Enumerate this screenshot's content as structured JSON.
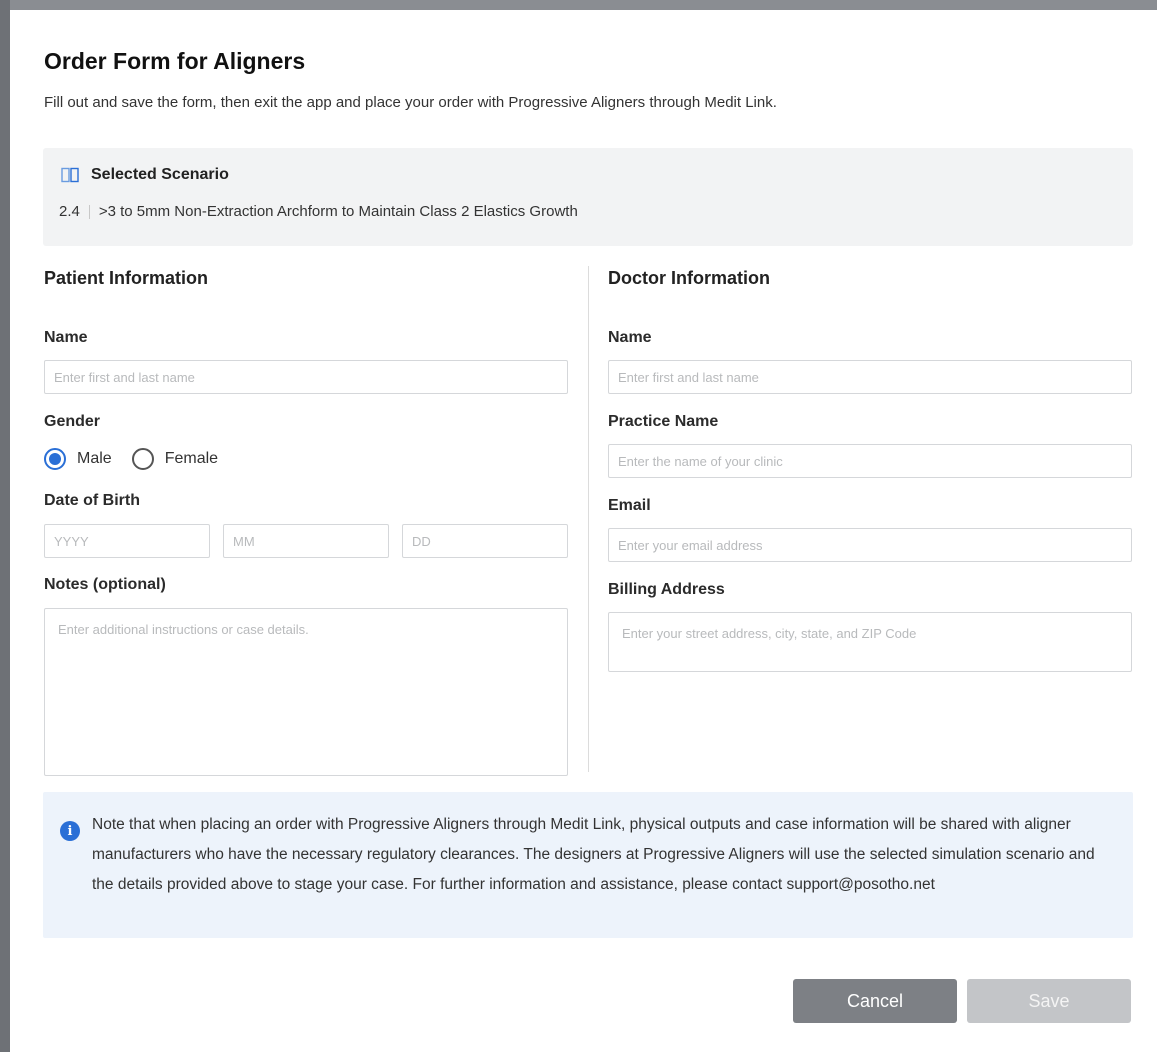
{
  "dialog": {
    "title": "Order Form for Aligners",
    "subtitle": "Fill out and save the form, then exit the app and place your order with Progressive Aligners through Medit Link."
  },
  "scenario": {
    "heading": "Selected Scenario",
    "number": "2.4",
    "description": ">3 to 5mm Non-Extraction Archform to Maintain Class 2 Elastics Growth",
    "icon": "book-open-icon"
  },
  "patient": {
    "section_title": "Patient Information",
    "name_label": "Name",
    "name_placeholder": "Enter first and last name",
    "name_value": "",
    "gender_label": "Gender",
    "gender_options": [
      "Male",
      "Female"
    ],
    "gender_selected": "Male",
    "dob_label": "Date of Birth",
    "dob_year_placeholder": "YYYY",
    "dob_month_placeholder": "MM",
    "dob_day_placeholder": "DD",
    "notes_label": "Notes (optional)",
    "notes_placeholder": "Enter additional instructions or case details."
  },
  "doctor": {
    "section_title": "Doctor Information",
    "name_label": "Name",
    "name_placeholder": "Enter first and last name",
    "practice_label": "Practice Name",
    "practice_placeholder": "Enter the name of your clinic",
    "email_label": "Email",
    "email_placeholder": "Enter your email address",
    "billing_label": "Billing Address",
    "billing_placeholder": "Enter your street address, city, state, and ZIP Code"
  },
  "info": {
    "icon": "info-icon",
    "text": "Note that when placing an order with Progressive Aligners through Medit Link, physical outputs and case information will be shared with aligner manufacturers who have the necessary regulatory clearances. The designers at Progressive Aligners will use the selected simulation scenario and the details provided above to stage your case. For further information and assistance, please contact support@posotho.net"
  },
  "buttons": {
    "cancel_label": "Cancel",
    "save_label": "Save"
  },
  "colors": {
    "accent": "#2a6fd6",
    "cancel_bg": "#7d8085",
    "save_disabled_bg": "#c3c5c8",
    "info_bg": "#edf3fb",
    "scenario_bg": "#f2f3f4"
  }
}
